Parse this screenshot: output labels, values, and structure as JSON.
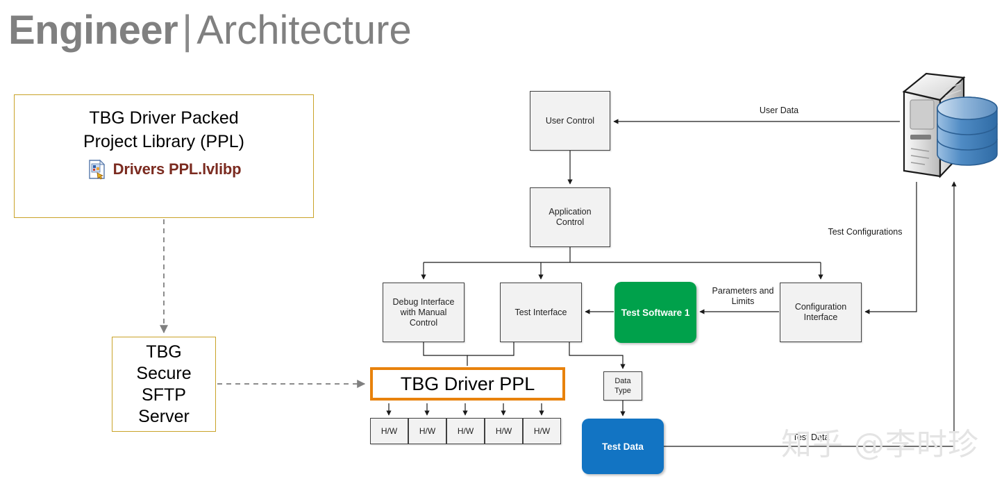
{
  "header": {
    "title_strong": "Engineer",
    "separator": "|",
    "title_light": "Architecture"
  },
  "colors": {
    "title_gray": "#808080",
    "tan_border": "#C9A227",
    "orange_border": "#E8820C",
    "green_fill": "#00A14B",
    "blue_fill": "#1274C3",
    "gray_box_fill": "#F2F2F2",
    "gray_box_border": "#404040",
    "file_name_text": "#7B2B20",
    "watermark": "#E4E4E4"
  },
  "left_column": {
    "library_box": {
      "title": "TBG Driver Packed\nProject Library (PPL)",
      "file_icon": "labview-library-file-icon",
      "file_name": "Drivers PPL.lvlibp"
    },
    "sftp_box": {
      "label": "TBG\nSecure\nSFTP\nServer"
    }
  },
  "diagram": {
    "driver_ppl_box": {
      "label": "TBG Driver PPL"
    },
    "hw_boxes": [
      {
        "label": "H/W"
      },
      {
        "label": "H/W"
      },
      {
        "label": "H/W"
      },
      {
        "label": "H/W"
      },
      {
        "label": "H/W"
      }
    ],
    "nodes": {
      "user_control": {
        "label": "User Control"
      },
      "application_control": {
        "label": "Application\nControl"
      },
      "debug_interface": {
        "label": "Debug Interface\nwith Manual\nControl"
      },
      "test_interface": {
        "label": "Test Interface"
      },
      "test_software": {
        "label": "Test Software 1"
      },
      "configuration_interface": {
        "label": "Configuration\nInterface"
      },
      "data_type": {
        "label": "Data\nType"
      },
      "test_data": {
        "label": "Test Data"
      }
    },
    "edge_labels": {
      "user_data": "User Data",
      "test_configurations": "Test Configurations",
      "parameters_and_limits": "Parameters and\nLimits",
      "test_data": "Test Data"
    },
    "server": {
      "icon": "server-database-icon"
    }
  },
  "watermark": {
    "text": "知乎 @李时珍"
  }
}
